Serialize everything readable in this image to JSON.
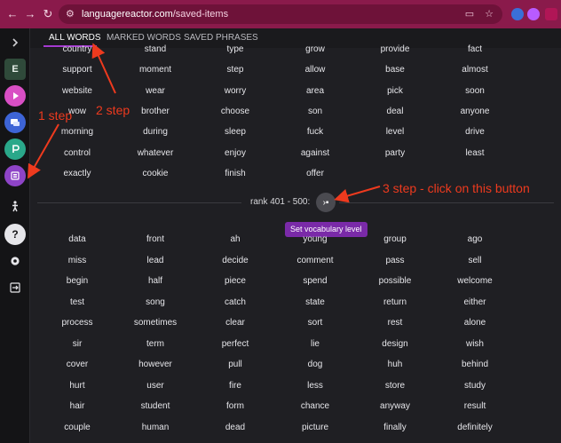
{
  "browser": {
    "url_host": "languagereactor.com",
    "url_path": "/saved-items"
  },
  "colors": {
    "chrome": "#8a1a4b",
    "accent": "#a43ad0",
    "annotation": "#ee3a1e",
    "background": "#1f1f23"
  },
  "sidebar": {
    "items": [
      {
        "icon": "chevron-right-icon"
      },
      {
        "icon": "e-letter-icon",
        "label": "E"
      },
      {
        "icon": "play-icon"
      },
      {
        "icon": "chat-icon"
      },
      {
        "icon": "p-badge-icon"
      },
      {
        "icon": "list-icon"
      },
      {
        "icon": "person-icon"
      },
      {
        "icon": "help-icon"
      },
      {
        "icon": "gear-icon"
      },
      {
        "icon": "exit-icon"
      }
    ]
  },
  "tabs": [
    {
      "label": "ALL WORDS",
      "active": true
    },
    {
      "label": "MARKED WORDS",
      "active": false
    },
    {
      "label": "SAVED PHRASES",
      "active": false
    }
  ],
  "words_top": [
    [
      "country",
      "stand",
      "type",
      "grow",
      "provide",
      "fact"
    ],
    [
      "support",
      "moment",
      "step",
      "allow",
      "base",
      "almost"
    ],
    [
      "website",
      "wear",
      "worry",
      "area",
      "pick",
      "soon"
    ],
    [
      "wow",
      "brother",
      "choose",
      "son",
      "deal",
      "anyone"
    ],
    [
      "morning",
      "during",
      "sleep",
      "fuck",
      "level",
      "drive"
    ],
    [
      "control",
      "whatever",
      "enjoy",
      "against",
      "party",
      "least"
    ],
    [
      "exactly",
      "cookie",
      "finish",
      "offer",
      "",
      ""
    ]
  ],
  "rank": {
    "label": "rank 401 - 500:",
    "tooltip": "Set vocabulary level"
  },
  "words_bottom": [
    [
      "data",
      "front",
      "ah",
      "young",
      "group",
      "ago"
    ],
    [
      "miss",
      "lead",
      "decide",
      "comment",
      "pass",
      "sell"
    ],
    [
      "begin",
      "half",
      "piece",
      "spend",
      "possible",
      "welcome"
    ],
    [
      "test",
      "song",
      "catch",
      "state",
      "return",
      "either"
    ],
    [
      "process",
      "sometimes",
      "clear",
      "sort",
      "rest",
      "alone"
    ],
    [
      "sir",
      "term",
      "perfect",
      "lie",
      "design",
      "wish"
    ],
    [
      "cover",
      "however",
      "pull",
      "dog",
      "huh",
      "behind"
    ],
    [
      "hurt",
      "user",
      "fire",
      "less",
      "store",
      "study"
    ],
    [
      "hair",
      "student",
      "form",
      "chance",
      "anyway",
      "result"
    ],
    [
      "couple",
      "human",
      "dead",
      "picture",
      "finally",
      "definitely"
    ]
  ],
  "annotations": {
    "step1": "1 step",
    "step2": "2 step",
    "step3": "3 step - click on this button"
  }
}
